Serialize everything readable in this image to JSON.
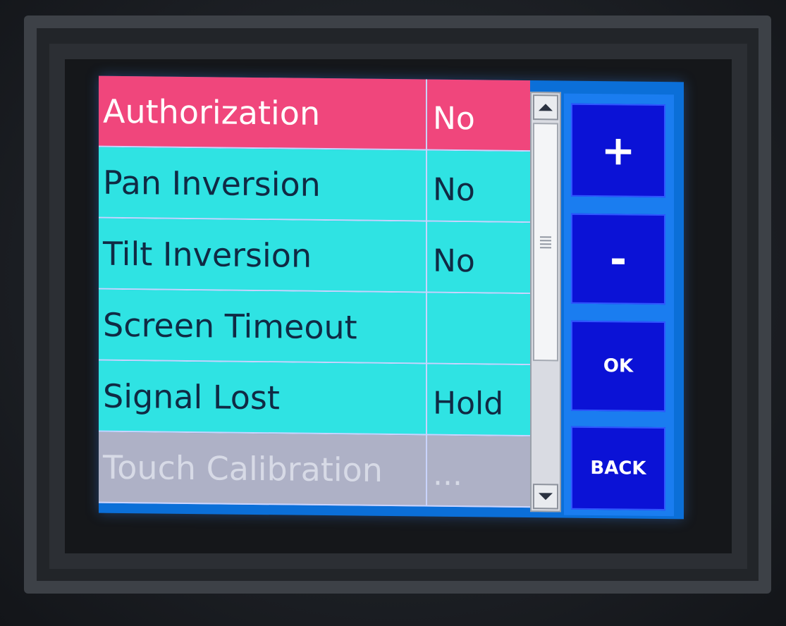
{
  "menu": {
    "rows": [
      {
        "label": "Authorization",
        "value": "No"
      },
      {
        "label": "Pan Inversion",
        "value": "No"
      },
      {
        "label": "Tilt Inversion",
        "value": "No"
      },
      {
        "label": "Screen Timeout",
        "value": ""
      },
      {
        "label": "Signal Lost",
        "value": "Hold"
      },
      {
        "label": "Touch Calibration",
        "value": "..."
      }
    ],
    "selected_index": 0
  },
  "buttons": {
    "plus": "+",
    "minus": "-",
    "ok": "OK",
    "back": "BACK"
  },
  "colors": {
    "selected_row": "#f0467c",
    "normal_row": "#2fe3e3",
    "disabled_row": "#aeb1c6",
    "button": "#0b12d6",
    "panel": "#1a7df0"
  }
}
